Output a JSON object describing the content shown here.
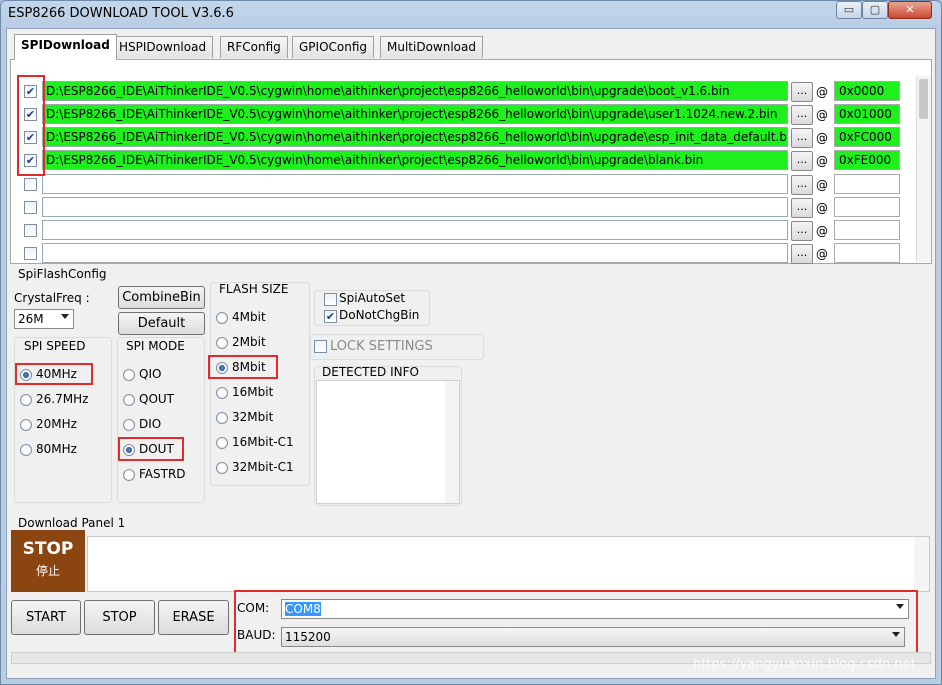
{
  "window": {
    "title": "ESP8266 DOWNLOAD TOOL V3.6.6",
    "controls": {
      "minimize": "▭",
      "maximize": "▢",
      "close": "✕"
    }
  },
  "tabs": [
    "SPIDownload",
    "HSPIDownload",
    "RFConfig",
    "GPIOConfig",
    "MultiDownload"
  ],
  "files": [
    {
      "checked": true,
      "path": "D:\\ESP8266_IDE\\AiThinkerIDE_V0.5\\cygwin\\home\\aithinker\\project\\esp8266_helloworld\\bin\\upgrade\\boot_v1.6.bin",
      "browse": "...",
      "at": "@",
      "address": "0x0000"
    },
    {
      "checked": true,
      "path": "D:\\ESP8266_IDE\\AiThinkerIDE_V0.5\\cygwin\\home\\aithinker\\project\\esp8266_helloworld\\bin\\upgrade\\user1.1024.new.2.bin",
      "browse": "...",
      "at": "@",
      "address": "0x01000"
    },
    {
      "checked": true,
      "path": "D:\\ESP8266_IDE\\AiThinkerIDE_V0.5\\cygwin\\home\\aithinker\\project\\esp8266_helloworld\\bin\\upgrade\\esp_init_data_default.bin",
      "browse": "...",
      "at": "@",
      "address": "0xFC000"
    },
    {
      "checked": true,
      "path": "D:\\ESP8266_IDE\\AiThinkerIDE_V0.5\\cygwin\\home\\aithinker\\project\\esp8266_helloworld\\bin\\upgrade\\blank.bin",
      "browse": "...",
      "at": "@",
      "address": "0xFE000"
    },
    {
      "checked": false,
      "path": "",
      "browse": "...",
      "at": "@",
      "address": ""
    },
    {
      "checked": false,
      "path": "",
      "browse": "...",
      "at": "@",
      "address": ""
    },
    {
      "checked": false,
      "path": "",
      "browse": "...",
      "at": "@",
      "address": ""
    },
    {
      "checked": false,
      "path": "",
      "browse": "...",
      "at": "@",
      "address": ""
    }
  ],
  "spi_flash_config": {
    "title": "SpiFlashConfig",
    "crystal_label": "CrystalFreq :",
    "crystal_value": "26M",
    "combine_button": "CombineBin",
    "default_button": "Default",
    "spi_speed": {
      "title": "SPI SPEED",
      "options": [
        "40MHz",
        "26.7MHz",
        "20MHz",
        "80MHz"
      ],
      "selected": "40MHz"
    },
    "spi_mode": {
      "title": "SPI MODE",
      "options": [
        "QIO",
        "QOUT",
        "DIO",
        "DOUT",
        "FASTRD"
      ],
      "selected": "DOUT"
    },
    "flash_size": {
      "title": "FLASH SIZE",
      "options": [
        "4Mbit",
        "2Mbit",
        "8Mbit",
        "16Mbit",
        "32Mbit",
        "16Mbit-C1",
        "32Mbit-C1"
      ],
      "selected": "8Mbit"
    },
    "spi_auto_set": {
      "label": "SpiAutoSet",
      "checked": false
    },
    "do_not_chg_bin": {
      "label": "DoNotChgBin",
      "checked": true
    },
    "lock_settings": {
      "label": "LOCK SETTINGS",
      "checked": false
    },
    "detected_info": {
      "title": "DETECTED INFO"
    }
  },
  "download_panel": {
    "title": "Download Panel 1",
    "state": {
      "en": "STOP",
      "cn": "停止"
    },
    "start_button": "START",
    "stop_button": "STOP",
    "erase_button": "ERASE",
    "com_label": "COM:",
    "com_value": "COM8",
    "baud_label": "BAUD:",
    "baud_value": "115200"
  },
  "watermark": "https://yangyuanxin.blog.csdn.net",
  "colors": {
    "loaded_green": "#1ef01e",
    "highlight_red": "#e12a2a",
    "stop_brown": "#8b4511"
  }
}
